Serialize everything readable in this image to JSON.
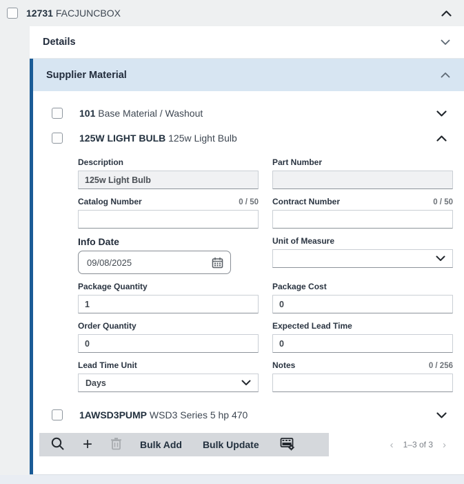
{
  "colors": {
    "accent_blue": "#1a5b96",
    "section_bg": "#d7e5f2",
    "page_bg": "#eef0f1",
    "toolbar_bg": "#d5d8dc"
  },
  "header": {
    "code": "12731",
    "name": "FACJUNCBOX"
  },
  "sections": {
    "details_label": "Details",
    "supplier_material_label": "Supplier Material"
  },
  "materials": {
    "row101": {
      "code": "101",
      "desc": "Base Material / Washout"
    },
    "row125": {
      "code": "125W LIGHT BULB",
      "desc": "125w Light Bulb"
    },
    "rowPump": {
      "code": "1AWSD3PUMP",
      "desc": "WSD3 Series 5 hp 470"
    }
  },
  "form": {
    "description": {
      "label": "Description",
      "value": "125w Light Bulb"
    },
    "part_number": {
      "label": "Part Number",
      "value": ""
    },
    "catalog_number": {
      "label": "Catalog Number",
      "counter": "0 / 50",
      "value": ""
    },
    "contract_number": {
      "label": "Contract Number",
      "counter": "0 / 50",
      "value": ""
    },
    "info_date": {
      "label": "Info Date",
      "value": "09/08/2025"
    },
    "unit_of_measure": {
      "label": "Unit of Measure",
      "value": ""
    },
    "package_quantity": {
      "label": "Package Quantity",
      "value": "1"
    },
    "package_cost": {
      "label": "Package Cost",
      "value": "0"
    },
    "order_quantity": {
      "label": "Order Quantity",
      "value": "0"
    },
    "expected_lead_time": {
      "label": "Expected Lead Time",
      "value": "0"
    },
    "lead_time_unit": {
      "label": "Lead Time Unit",
      "value": "Days"
    },
    "notes": {
      "label": "Notes",
      "counter": "0 / 256",
      "value": ""
    }
  },
  "toolbar": {
    "bulk_add_label": "Bulk Add",
    "bulk_update_label": "Bulk Update",
    "plus_glyph": "+",
    "icons": [
      "search-icon",
      "add-icon",
      "delete-icon",
      "personalize-columns-icon"
    ]
  },
  "pagination": {
    "text": "1–3 of 3",
    "prev_glyph": "‹",
    "next_glyph": "›"
  }
}
